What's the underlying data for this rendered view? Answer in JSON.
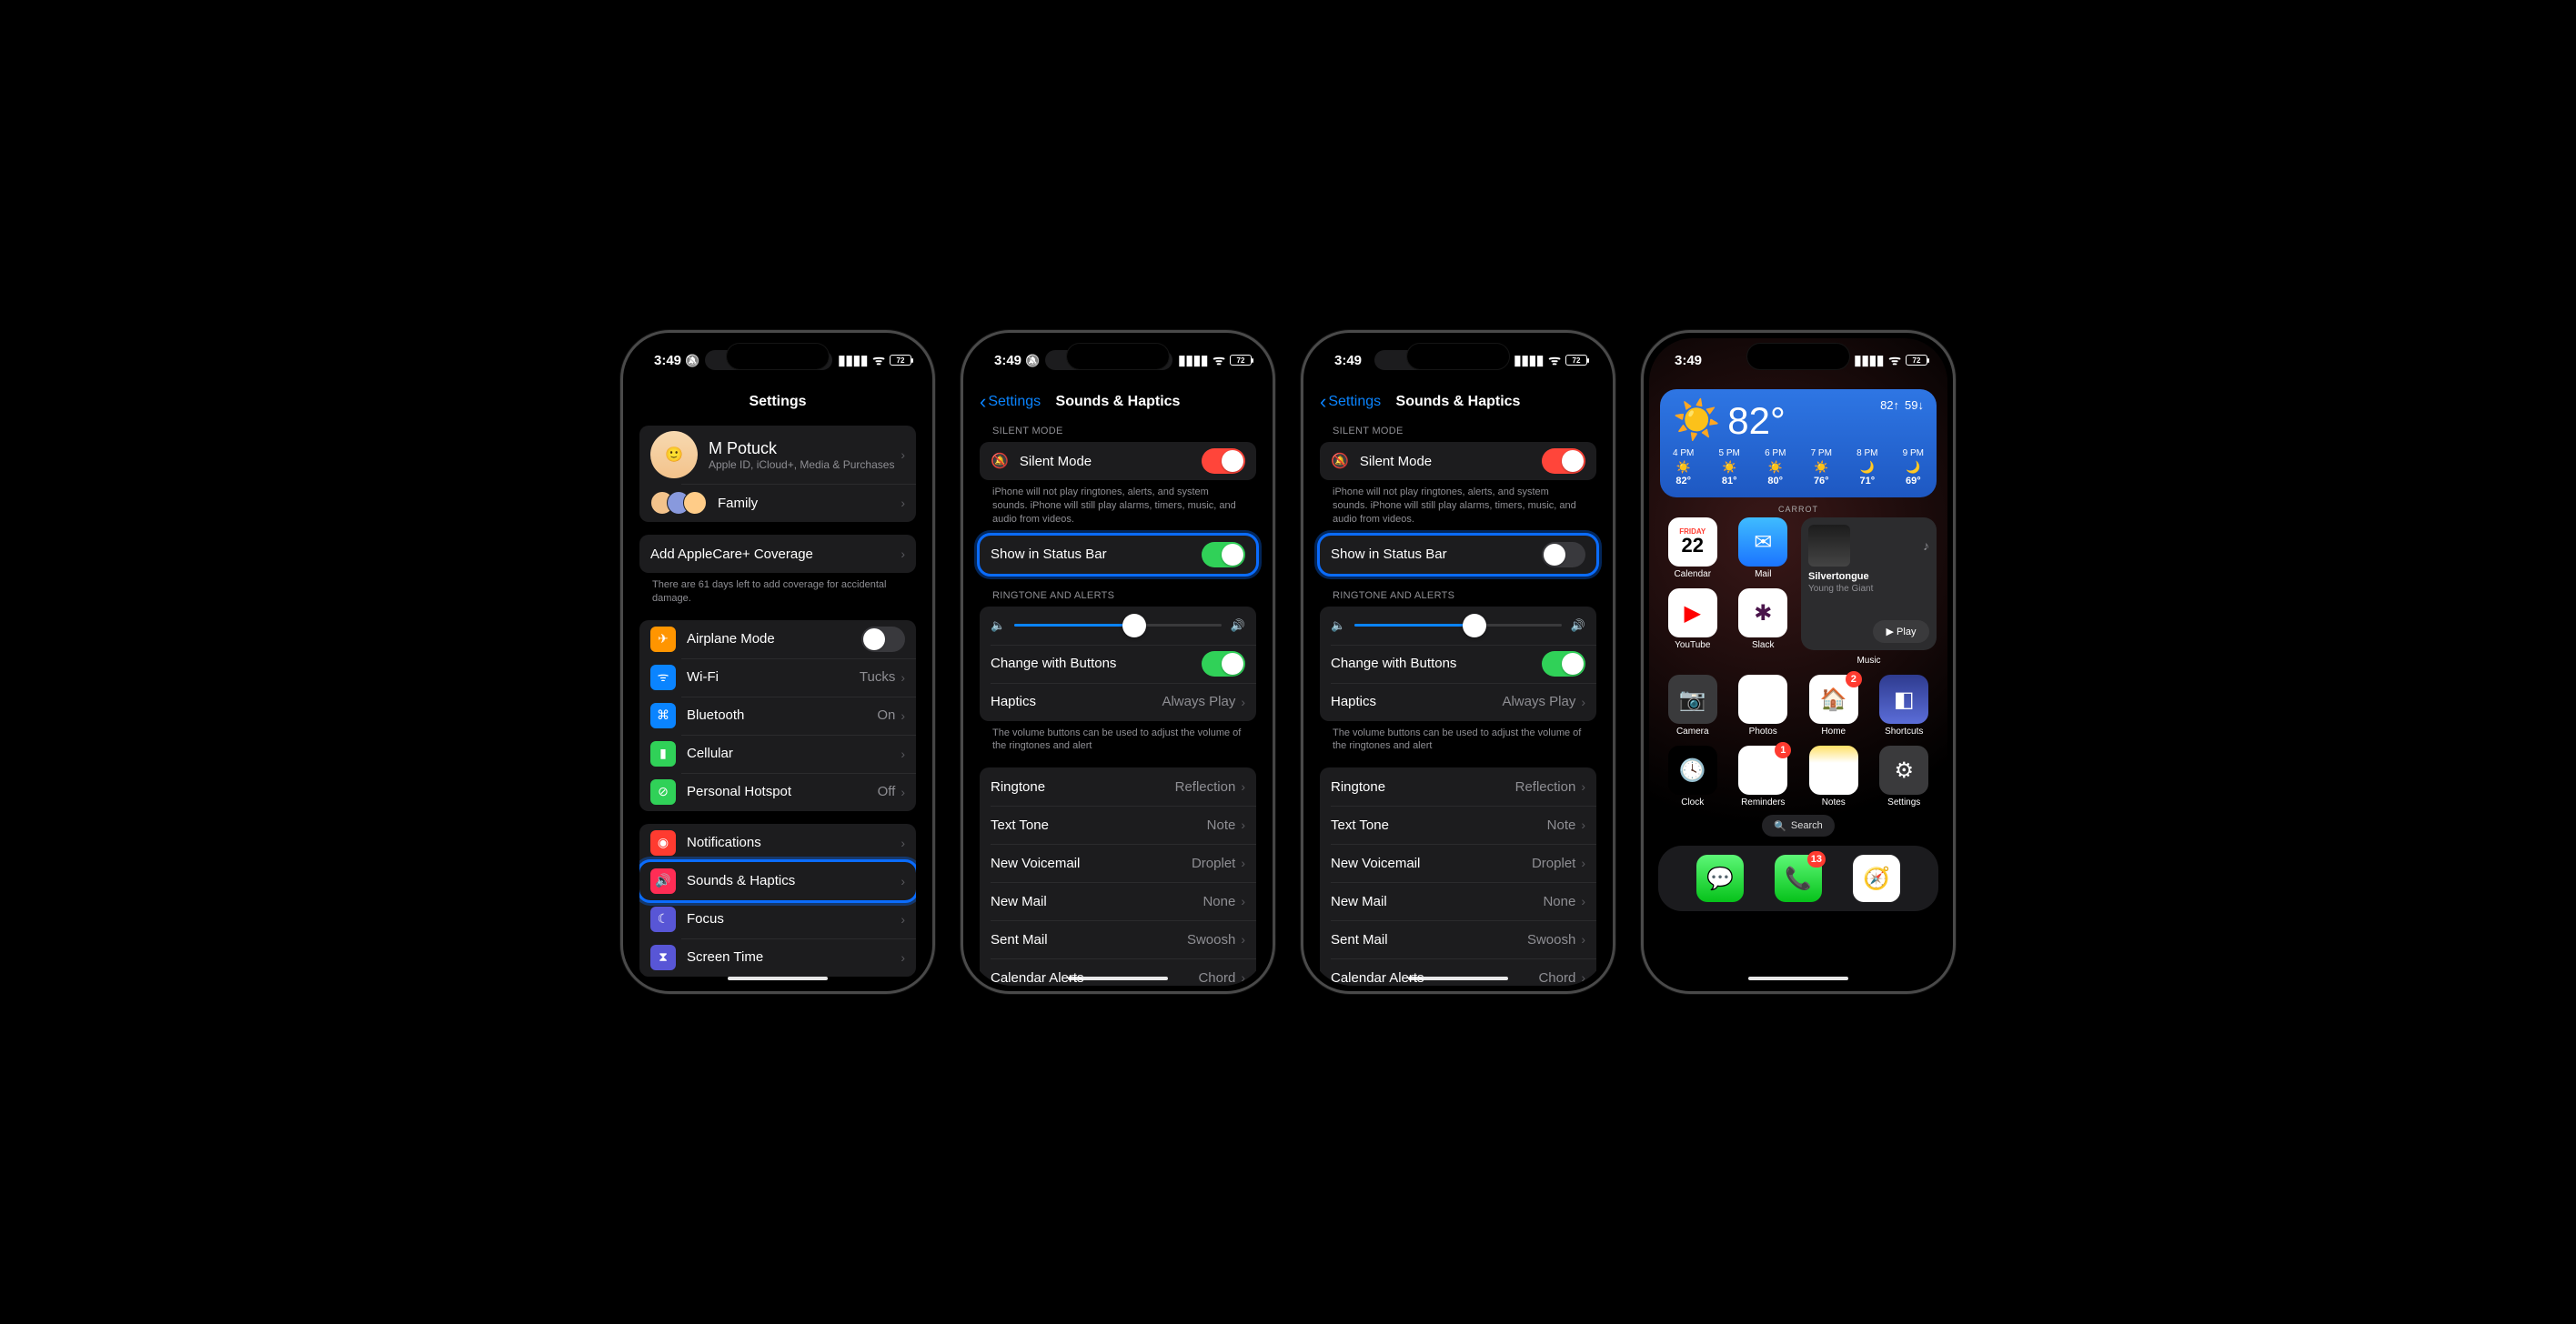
{
  "status": {
    "time": "3:49",
    "battery": "72",
    "silent_icon": "🔕"
  },
  "phone1": {
    "title": "Settings",
    "profile": {
      "name": "M Potuck",
      "sub": "Apple ID, iCloud+, Media & Purchases"
    },
    "family": "Family",
    "applecare": "Add AppleCare+ Coverage",
    "applecare_footer": "There are 61 days left to add coverage for accidental damage.",
    "rows": [
      {
        "label": "Airplane Mode",
        "value": "",
        "type": "toggle",
        "on": false,
        "color": "#ff9500",
        "icon": "✈︎"
      },
      {
        "label": "Wi-Fi",
        "value": "Tucks",
        "color": "#0a84ff",
        "icon": "ᯤ"
      },
      {
        "label": "Bluetooth",
        "value": "On",
        "color": "#0a84ff",
        "icon": "⌘"
      },
      {
        "label": "Cellular",
        "value": "",
        "color": "#30d158",
        "icon": "▮"
      },
      {
        "label": "Personal Hotspot",
        "value": "Off",
        "color": "#30d158",
        "icon": "⊘"
      }
    ],
    "rows2": [
      {
        "label": "Notifications",
        "color": "#ff3b30",
        "icon": "◉"
      },
      {
        "label": "Sounds & Haptics",
        "color": "#ff2d55",
        "icon": "🔊",
        "highlight": true
      },
      {
        "label": "Focus",
        "color": "#5856d6",
        "icon": "☾"
      },
      {
        "label": "Screen Time",
        "color": "#5856d6",
        "icon": "⧗"
      }
    ]
  },
  "sounds": {
    "back": "Settings",
    "title": "Sounds & Haptics",
    "sec_silent": "SILENT MODE",
    "silent_mode": "Silent Mode",
    "silent_footer": "iPhone will not play ringtones, alerts, and system sounds. iPhone will still play alarms, timers, music, and audio from videos.",
    "show_status": "Show in Status Bar",
    "sec_ring": "RINGTONE AND ALERTS",
    "change_buttons": "Change with Buttons",
    "haptics": "Haptics",
    "haptics_val": "Always Play",
    "ring_footer": "The volume buttons can be used to adjust the volume of the ringtones and alert",
    "tone_rows": [
      {
        "label": "Ringtone",
        "value": "Reflection"
      },
      {
        "label": "Text Tone",
        "value": "Note"
      },
      {
        "label": "New Voicemail",
        "value": "Droplet"
      },
      {
        "label": "New Mail",
        "value": "None"
      },
      {
        "label": "Sent Mail",
        "value": "Swoosh"
      },
      {
        "label": "Calendar Alerts",
        "value": "Chord"
      }
    ]
  },
  "phone2": {
    "show_status_on": true,
    "slider_pct": 58
  },
  "phone3": {
    "show_status_on": false,
    "slider_pct": 58
  },
  "home": {
    "weather": {
      "temp": "82°",
      "hi": "82↑",
      "lo": "59↓",
      "icon": "☀️",
      "caption": "CARROT",
      "hours": [
        {
          "h": "4 PM",
          "ic": "☀️",
          "t": "82°"
        },
        {
          "h": "5 PM",
          "ic": "☀️",
          "t": "81°"
        },
        {
          "h": "6 PM",
          "ic": "☀️",
          "t": "80°"
        },
        {
          "h": "7 PM",
          "ic": "☀️",
          "t": "76°"
        },
        {
          "h": "8 PM",
          "ic": "🌙",
          "t": "71°"
        },
        {
          "h": "9 PM",
          "ic": "🌙",
          "t": "69°"
        }
      ]
    },
    "music": {
      "title": "Silvertongue",
      "artist": "Young the Giant",
      "play": "Play",
      "caption": "Music"
    },
    "apps_row1": [
      {
        "name": "Calendar",
        "type": "cal",
        "day": "FRIDAY",
        "date": "22"
      },
      {
        "name": "Mail",
        "bg": "linear-gradient(#3fbcff,#1b74ff)",
        "icon": "✉︎"
      }
    ],
    "apps_row2": [
      {
        "name": "YouTube",
        "bg": "#fff",
        "icon": "▶",
        "iconColor": "#ff0000"
      },
      {
        "name": "Slack",
        "bg": "#fff",
        "icon": "✱",
        "iconColor": "#4a154b"
      }
    ],
    "apps_row3": [
      {
        "name": "Camera",
        "bg": "#3a3a3c",
        "icon": "📷"
      },
      {
        "name": "Photos",
        "bg": "#fff",
        "icon": "❀"
      },
      {
        "name": "Home",
        "bg": "#fff",
        "icon": "🏠",
        "badge": "2"
      },
      {
        "name": "Shortcuts",
        "bg": "linear-gradient(#2e3b8f,#5b6dd8)",
        "icon": "◧"
      }
    ],
    "apps_row4": [
      {
        "name": "Clock",
        "bg": "#000",
        "icon": "🕓"
      },
      {
        "name": "Reminders",
        "bg": "#fff",
        "icon": "≣",
        "badge": "1"
      },
      {
        "name": "Notes",
        "bg": "linear-gradient(#ffe066,#fff 35%)",
        "icon": "≡"
      },
      {
        "name": "Settings",
        "bg": "#3a3a3c",
        "icon": "⚙︎"
      }
    ],
    "search": "Search",
    "dock": [
      {
        "name": "Messages",
        "bg": "linear-gradient(#5df777,#06c21a)",
        "icon": "💬"
      },
      {
        "name": "Phone",
        "bg": "linear-gradient(#5df777,#06c21a)",
        "icon": "📞",
        "badge": "13"
      },
      {
        "name": "Safari",
        "bg": "#fff",
        "icon": "🧭"
      }
    ]
  }
}
